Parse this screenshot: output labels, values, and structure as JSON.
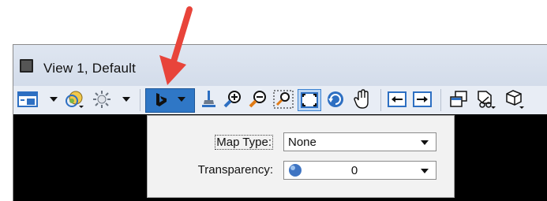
{
  "window": {
    "title": "View 1, Default"
  },
  "toolbar": {
    "buttons": [
      {
        "name": "view-attributes",
        "icon": "view-attributes-icon"
      },
      {
        "name": "display-style",
        "icon": "display-style-icon"
      },
      {
        "name": "lighting",
        "icon": "sun-icon"
      },
      {
        "name": "bing-maps",
        "icon": "bing-icon"
      },
      {
        "name": "brush",
        "icon": "brush-icon"
      },
      {
        "name": "zoom-in",
        "icon": "zoom-in-icon"
      },
      {
        "name": "zoom-out",
        "icon": "zoom-out-icon"
      },
      {
        "name": "window-area",
        "icon": "window-area-icon"
      },
      {
        "name": "fit-view",
        "icon": "fit-view-icon"
      },
      {
        "name": "rotate-view",
        "icon": "rotate-view-icon"
      },
      {
        "name": "pan-view",
        "icon": "hand-icon"
      },
      {
        "name": "view-previous",
        "icon": "view-previous-icon"
      },
      {
        "name": "view-next",
        "icon": "view-next-icon"
      },
      {
        "name": "copy-view",
        "icon": "copy-view-icon"
      },
      {
        "name": "clip-volume",
        "icon": "clip-volume-icon"
      },
      {
        "name": "3d-box",
        "icon": "box-icon"
      }
    ]
  },
  "popup": {
    "map_type_label": "Map Type:",
    "map_type_value": "None",
    "transparency_label": "Transparency:",
    "transparency_value": "0"
  },
  "colors": {
    "accent": "#2f77c6",
    "annotation": "#e8443a",
    "toolbar_bg": "#e8edf5",
    "title_bg": "#d6deeb"
  }
}
